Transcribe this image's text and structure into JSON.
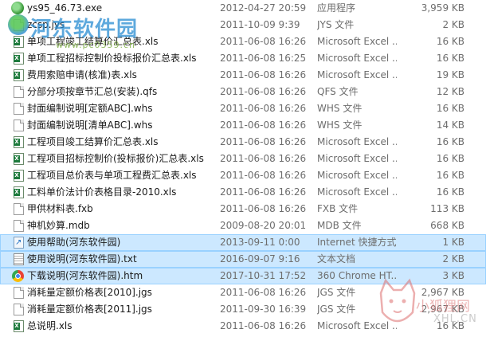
{
  "files": [
    {
      "name": "ys95_46.73.exe",
      "date": "2012-04-27 20:59",
      "type": "应用程序",
      "size": "3,959 KB",
      "icon": "exe-icon"
    },
    {
      "name": "zcsp.jys",
      "date": "2011-10-09 9:39",
      "type": "JYS 文件",
      "size": "2 KB",
      "icon": "file-icon"
    },
    {
      "name": "单项工程竣工结算价汇总表.xls",
      "date": "2011-06-08 16:26",
      "type": "Microsoft Excel ...",
      "size": "16 KB",
      "icon": "excel-icon"
    },
    {
      "name": "单项工程招标控制价投标报价汇总表.xls",
      "date": "2011-06-08 16:25",
      "type": "Microsoft Excel ...",
      "size": "16 KB",
      "icon": "excel-icon"
    },
    {
      "name": "费用索赔申请(核准)表.xls",
      "date": "2011-06-08 16:26",
      "type": "Microsoft Excel ...",
      "size": "19 KB",
      "icon": "excel-icon"
    },
    {
      "name": "分部分项按章节汇总(安装).qfs",
      "date": "2011-06-08 16:26",
      "type": "QFS 文件",
      "size": "12 KB",
      "icon": "file-icon"
    },
    {
      "name": "封面编制说明[定额ABC].whs",
      "date": "2011-06-08 16:26",
      "type": "WHS 文件",
      "size": "16 KB",
      "icon": "file-icon"
    },
    {
      "name": "封面编制说明[清单ABC].whs",
      "date": "2011-06-08 16:26",
      "type": "WHS 文件",
      "size": "14 KB",
      "icon": "file-icon"
    },
    {
      "name": "工程项目竣工结算价汇总表.xls",
      "date": "2011-06-08 16:26",
      "type": "Microsoft Excel ...",
      "size": "16 KB",
      "icon": "excel-icon"
    },
    {
      "name": "工程项目招标控制价(投标报价)汇总表.xls",
      "date": "2011-06-08 16:26",
      "type": "Microsoft Excel ...",
      "size": "16 KB",
      "icon": "excel-icon"
    },
    {
      "name": "工程项目总价表与单项工程费汇总表.xls",
      "date": "2011-06-08 16:26",
      "type": "Microsoft Excel ...",
      "size": "16 KB",
      "icon": "excel-icon"
    },
    {
      "name": "工料单价法计价表格目录-2010.xls",
      "date": "2011-06-08 16:26",
      "type": "Microsoft Excel ...",
      "size": "16 KB",
      "icon": "excel-icon"
    },
    {
      "name": "甲供材料表.fxb",
      "date": "2011-06-08 16:26",
      "type": "FXB 文件",
      "size": "113 KB",
      "icon": "file-icon"
    },
    {
      "name": "神机妙算.mdb",
      "date": "2009-08-20 20:01",
      "type": "MDB 文件",
      "size": "668 KB",
      "icon": "file-icon"
    },
    {
      "name": "使用帮助(河东软件园)",
      "date": "2013-09-11 0:00",
      "type": "Internet 快捷方式",
      "size": "1 KB",
      "icon": "shortcut-icon",
      "selected": true
    },
    {
      "name": "使用说明(河东软件园).txt",
      "date": "2016-09-07 9:16",
      "type": "文本文档",
      "size": "2 KB",
      "icon": "text-icon",
      "selected": true
    },
    {
      "name": "下载说明(河东软件园).htm",
      "date": "2017-10-31 17:52",
      "type": "360 Chrome HT...",
      "size": "3 KB",
      "icon": "chrome-icon",
      "selected": true
    },
    {
      "name": "消耗量定额价格表[2010].jgs",
      "date": "2011-06-08 16:26",
      "type": "JGS 文件",
      "size": "2,967 KB",
      "icon": "file-icon"
    },
    {
      "name": "消耗量定额价格表[2011].jgs",
      "date": "2011-09-30 16:39",
      "type": "JGS 文件",
      "size": "2,967 KB",
      "icon": "file-icon"
    },
    {
      "name": "总说明.xls",
      "date": "2011-06-08 16:26",
      "type": "Microsoft Excel ...",
      "size": "16 KB",
      "icon": "excel-icon"
    }
  ],
  "watermark_top": {
    "title": "河东软件园",
    "subtitle": "www.pc0359.cn"
  },
  "watermark_bottom": {
    "title": "小狐狸网",
    "subtitle": "XHL.CN"
  },
  "colors": {
    "selection": "#cce8ff",
    "selection_border": "#99d1ff",
    "secondary_text": "#6d6d6d"
  }
}
